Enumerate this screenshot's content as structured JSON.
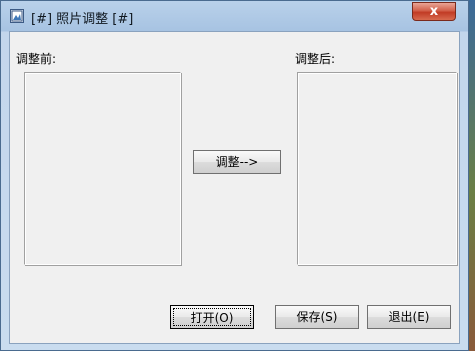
{
  "window": {
    "title": "[#] 照片调整 [#]",
    "close_label": "x"
  },
  "labels": {
    "before": "调整前:",
    "after": "调整后:"
  },
  "buttons": {
    "adjust": "调整-->",
    "open": "打开(O)",
    "save": "保存(S)",
    "exit": "退出(E)"
  }
}
